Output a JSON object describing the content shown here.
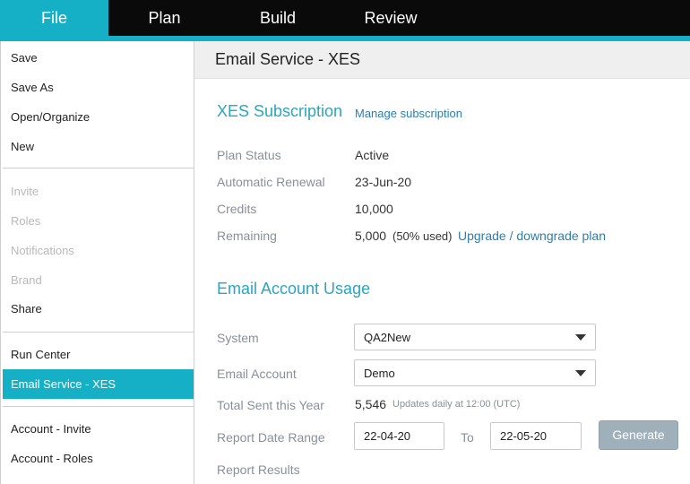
{
  "nav": {
    "tabs": [
      {
        "label": "File",
        "active": true
      },
      {
        "label": "Plan",
        "active": false
      },
      {
        "label": "Build",
        "active": false
      },
      {
        "label": "Review",
        "active": false
      }
    ],
    "accent_color": "#15b0c6"
  },
  "sidebar": {
    "items": [
      {
        "label": "Save",
        "state": "enabled"
      },
      {
        "label": "Save As",
        "state": "enabled"
      },
      {
        "label": "Open/Organize",
        "state": "enabled"
      },
      {
        "label": "New",
        "state": "enabled"
      },
      {
        "label": "Invite",
        "state": "disabled"
      },
      {
        "label": "Roles",
        "state": "disabled"
      },
      {
        "label": "Notifications",
        "state": "disabled"
      },
      {
        "label": "Brand",
        "state": "disabled"
      },
      {
        "label": "Share",
        "state": "enabled"
      },
      {
        "label": "Run Center",
        "state": "enabled"
      },
      {
        "label": "Email Service - XES",
        "state": "selected"
      },
      {
        "label": "Account - Invite",
        "state": "enabled"
      },
      {
        "label": "Account - Roles",
        "state": "enabled"
      }
    ]
  },
  "main": {
    "title": "Email Service - XES",
    "subscription": {
      "heading": "XES Subscription",
      "manage_link": "Manage subscription",
      "plan_status_label": "Plan Status",
      "plan_status_value": "Active",
      "renewal_label": "Automatic Renewal",
      "renewal_value": "23-Jun-20",
      "credits_label": "Credits",
      "credits_value": "10,000",
      "remaining_label": "Remaining",
      "remaining_value": "5,000",
      "remaining_pct": "(50% used)",
      "upgrade_link": "Upgrade / downgrade plan"
    },
    "usage": {
      "heading": "Email Account Usage",
      "system_label": "System",
      "system_value": "QA2New",
      "account_label": "Email Account",
      "account_value": "Demo",
      "total_sent_label": "Total Sent this Year",
      "total_sent_value": "5,546",
      "total_sent_note": "Updates daily at 12:00 (UTC)",
      "range_label": "Report Date Range",
      "range_from": "22-04-20",
      "range_to_label": "To",
      "range_to": "22-05-20",
      "generate_label": "Generate",
      "results_label": "Report Results"
    }
  }
}
